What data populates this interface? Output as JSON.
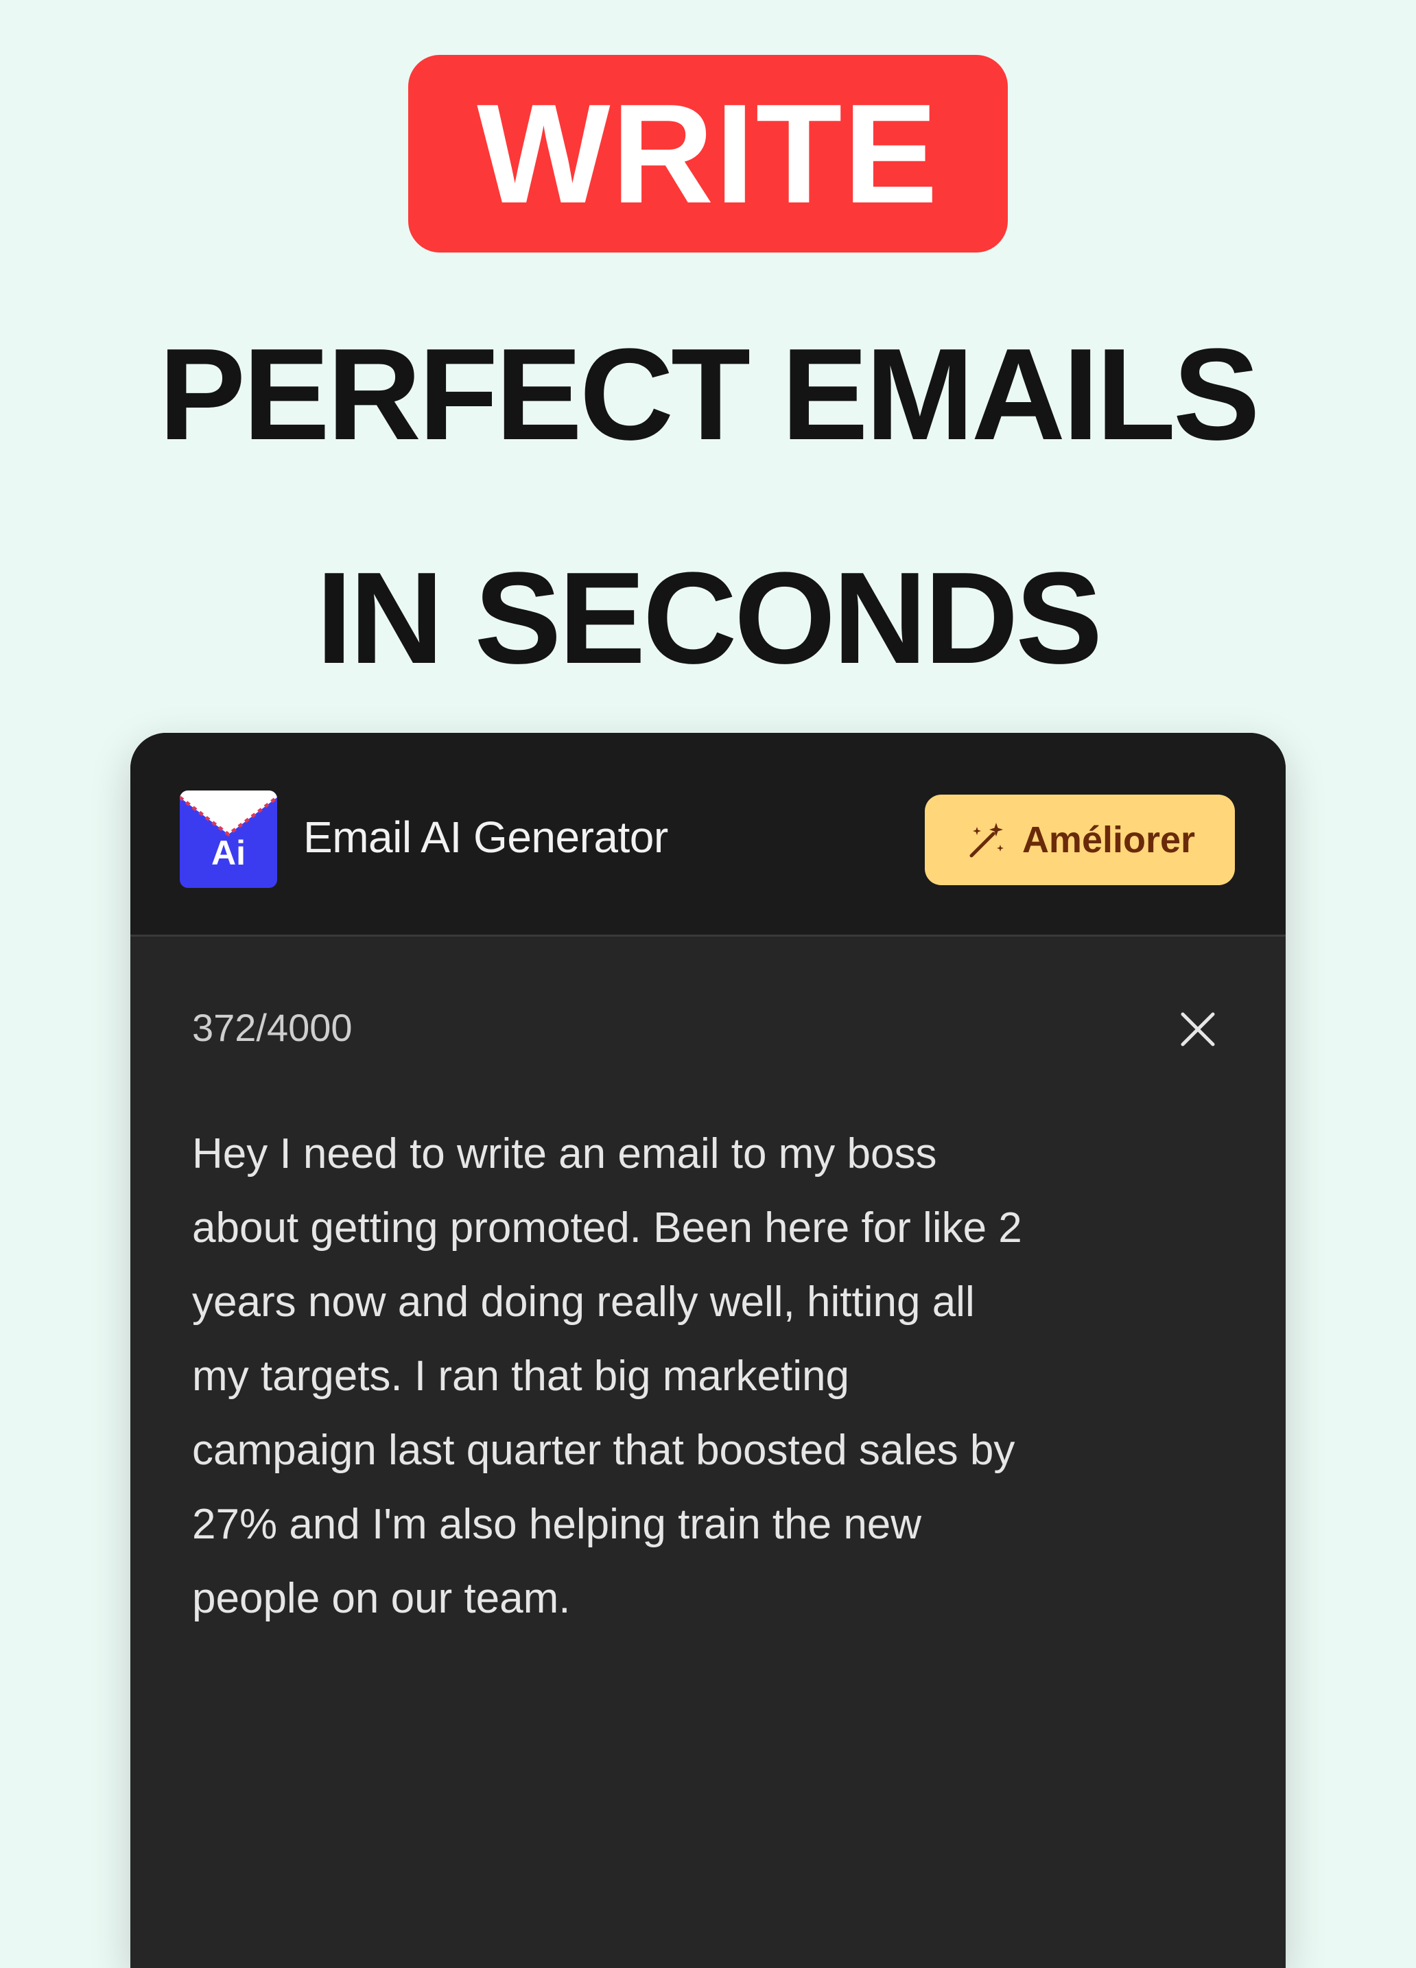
{
  "badge": {
    "text": "WRITE"
  },
  "headline": {
    "line1": "PERFECT EMAILS",
    "line2": "IN SECONDS"
  },
  "app": {
    "logo_text": "Ai",
    "title": "Email AI Generator",
    "improve_label": "Améliorer",
    "improve_icon": "magic-wand-icon"
  },
  "editor": {
    "counter": "372/4000",
    "close_icon": "close-icon",
    "text": "Hey I need to write an email to my boss\nabout getting promoted. Been here for like 2\nyears now and doing really well, hitting all\nmy targets. I ran that big marketing\ncampaign last quarter that boosted sales by\n27% and I'm also helping train the new\npeople on our team."
  },
  "colors": {
    "background": "#ebf9f4",
    "badge": "#fd3838",
    "panel": "#262626",
    "header": "#1b1b1b",
    "button": "#ffd77a",
    "button_text": "#6a2a0a",
    "logo": "#3b3cf0"
  }
}
